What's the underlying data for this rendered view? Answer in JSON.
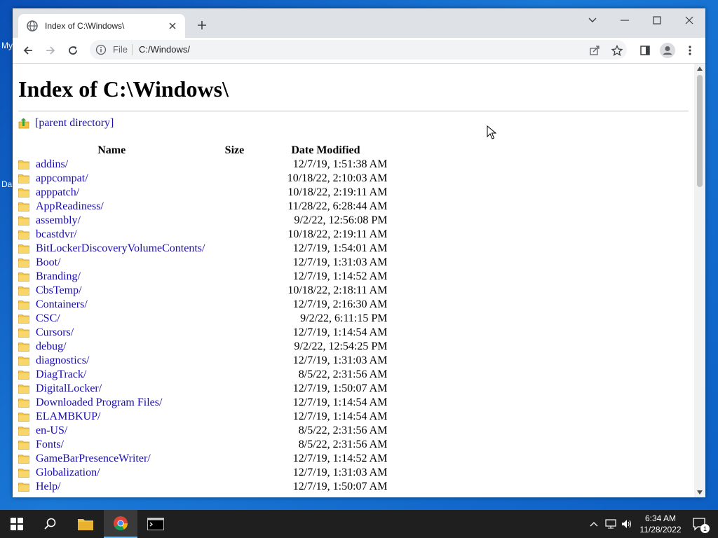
{
  "desktop": {
    "labels": [
      "My",
      "Da"
    ]
  },
  "browser": {
    "tab_title": "Index of C:\\Windows\\",
    "omnibox": {
      "scheme_label": "File",
      "url": "C:/Windows/"
    }
  },
  "page": {
    "heading": "Index of C:\\Windows\\",
    "parent_link": "[parent directory]",
    "columns": {
      "name": "Name",
      "size": "Size",
      "date": "Date Modified"
    },
    "rows": [
      {
        "name": "addins/",
        "size": "",
        "date": "12/7/19, 1:51:38 AM"
      },
      {
        "name": "appcompat/",
        "size": "",
        "date": "10/18/22, 2:10:03 AM"
      },
      {
        "name": "apppatch/",
        "size": "",
        "date": "10/18/22, 2:19:11 AM"
      },
      {
        "name": "AppReadiness/",
        "size": "",
        "date": "11/28/22, 6:28:44 AM"
      },
      {
        "name": "assembly/",
        "size": "",
        "date": "9/2/22, 12:56:08 PM"
      },
      {
        "name": "bcastdvr/",
        "size": "",
        "date": "10/18/22, 2:19:11 AM"
      },
      {
        "name": "BitLockerDiscoveryVolumeContents/",
        "size": "",
        "date": "12/7/19, 1:54:01 AM"
      },
      {
        "name": "Boot/",
        "size": "",
        "date": "12/7/19, 1:31:03 AM"
      },
      {
        "name": "Branding/",
        "size": "",
        "date": "12/7/19, 1:14:52 AM"
      },
      {
        "name": "CbsTemp/",
        "size": "",
        "date": "10/18/22, 2:18:11 AM"
      },
      {
        "name": "Containers/",
        "size": "",
        "date": "12/7/19, 2:16:30 AM"
      },
      {
        "name": "CSC/",
        "size": "",
        "date": "9/2/22, 6:11:15 PM"
      },
      {
        "name": "Cursors/",
        "size": "",
        "date": "12/7/19, 1:14:54 AM"
      },
      {
        "name": "debug/",
        "size": "",
        "date": "9/2/22, 12:54:25 PM"
      },
      {
        "name": "diagnostics/",
        "size": "",
        "date": "12/7/19, 1:31:03 AM"
      },
      {
        "name": "DiagTrack/",
        "size": "",
        "date": "8/5/22, 2:31:56 AM"
      },
      {
        "name": "DigitalLocker/",
        "size": "",
        "date": "12/7/19, 1:50:07 AM"
      },
      {
        "name": "Downloaded Program Files/",
        "size": "",
        "date": "12/7/19, 1:14:54 AM"
      },
      {
        "name": "ELAMBKUP/",
        "size": "",
        "date": "12/7/19, 1:14:54 AM"
      },
      {
        "name": "en-US/",
        "size": "",
        "date": "8/5/22, 2:31:56 AM"
      },
      {
        "name": "Fonts/",
        "size": "",
        "date": "8/5/22, 2:31:56 AM"
      },
      {
        "name": "GameBarPresenceWriter/",
        "size": "",
        "date": "12/7/19, 1:14:52 AM"
      },
      {
        "name": "Globalization/",
        "size": "",
        "date": "12/7/19, 1:31:03 AM"
      },
      {
        "name": "Help/",
        "size": "",
        "date": "12/7/19, 1:50:07 AM"
      }
    ]
  },
  "taskbar": {
    "time": "6:34 AM",
    "date": "11/28/2022",
    "notification_count": "1"
  },
  "colors": {
    "link": "#1a0dab",
    "folder": "#f5c542",
    "taskbar": "#1f1f1f"
  }
}
